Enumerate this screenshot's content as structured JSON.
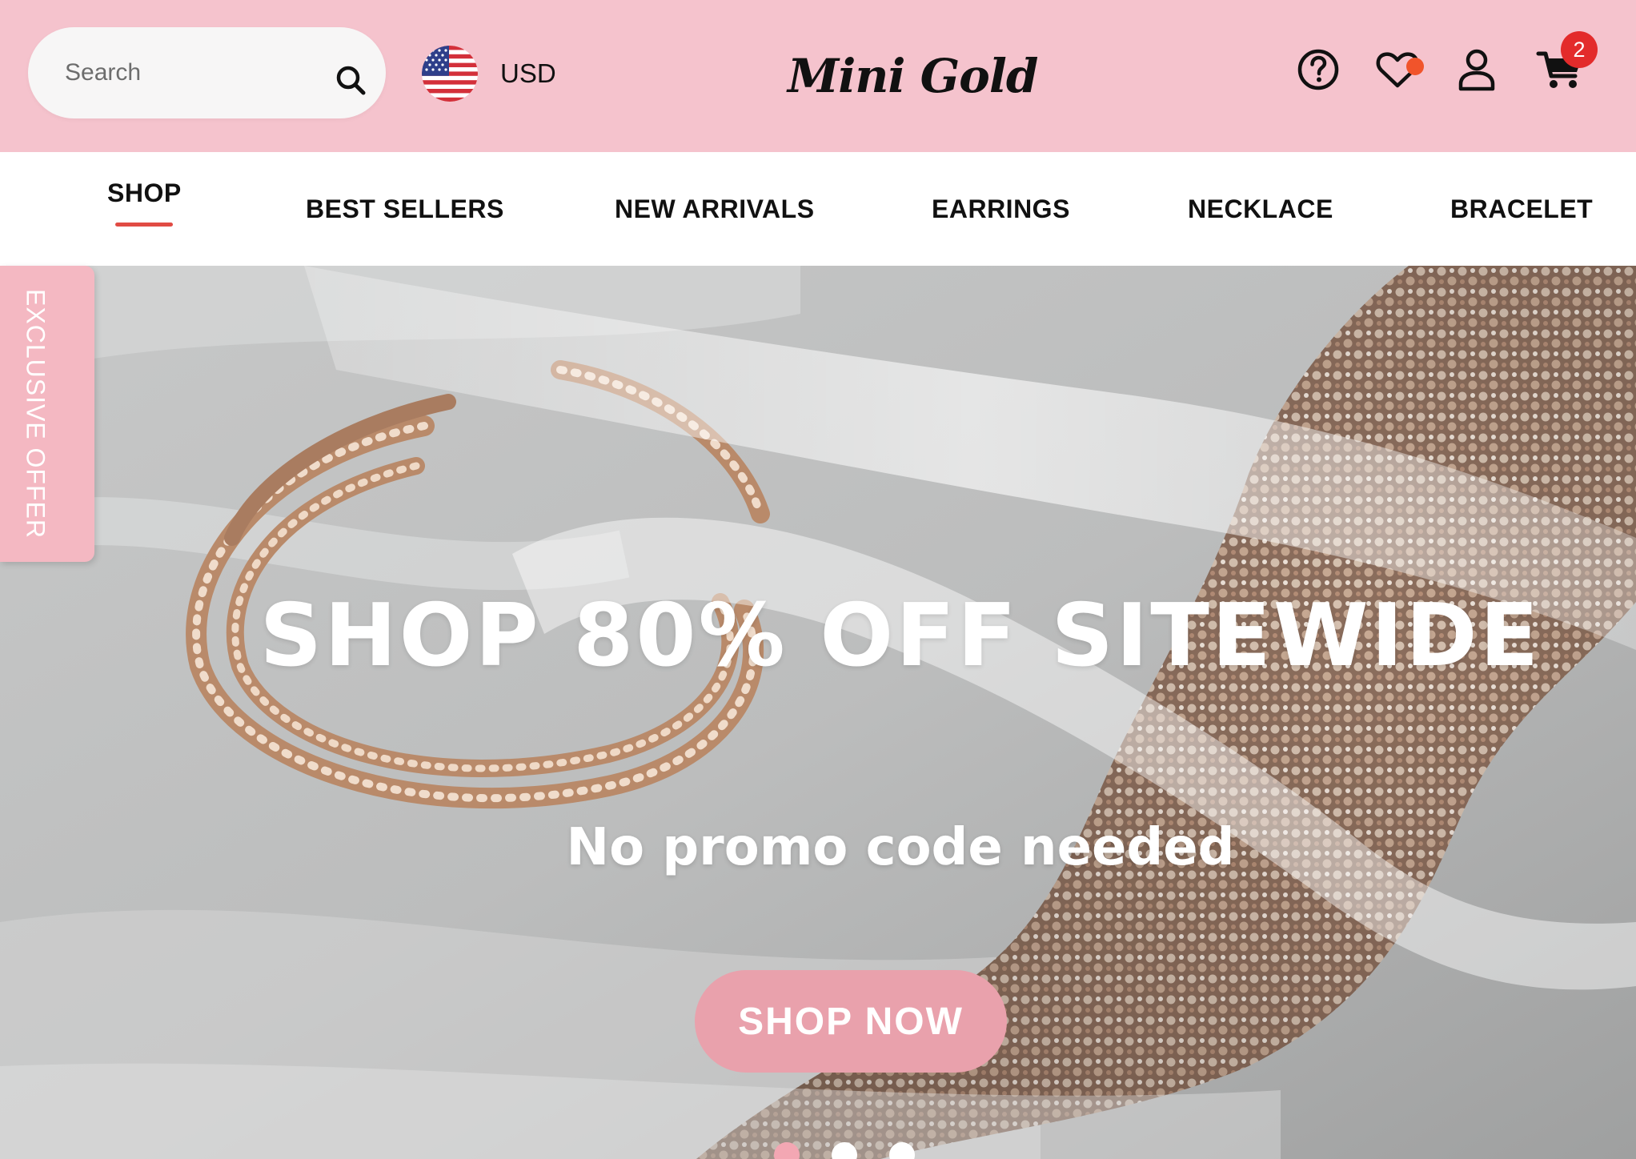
{
  "header": {
    "search": {
      "placeholder": "Search",
      "value": ""
    },
    "currency": {
      "label": "USD",
      "flag_icon": "us-flag-icon"
    },
    "logo_text": "Mini Gold",
    "icons": [
      "help-icon",
      "heart-icon",
      "user-icon",
      "cart-icon"
    ],
    "wishlist_dot_color": "#f1542b",
    "cart_count": "2"
  },
  "nav": {
    "items": [
      {
        "label": "SHOP",
        "active": true
      },
      {
        "label": "BEST SELLERS",
        "active": false
      },
      {
        "label": "NEW ARRIVALS",
        "active": false
      },
      {
        "label": "EARRINGS",
        "active": false
      },
      {
        "label": "NECKLACE",
        "active": false
      },
      {
        "label": "BRACELET",
        "active": false
      }
    ],
    "active_underline_color": "#e14b44"
  },
  "hero": {
    "title": "SHOP 80% OFF SITEWIDE",
    "subtitle": "No promo code needed",
    "cta_label": "SHOP NOW",
    "cta_color": "#e9a1ac",
    "slide_count": 3,
    "active_slide": 1
  },
  "side_tab": {
    "label": "EXCLUSIVE OFFER"
  },
  "colors": {
    "header_bg": "#f5c3cd",
    "accent_pink": "#f4b8c2",
    "badge_red": "#e32b2b"
  }
}
